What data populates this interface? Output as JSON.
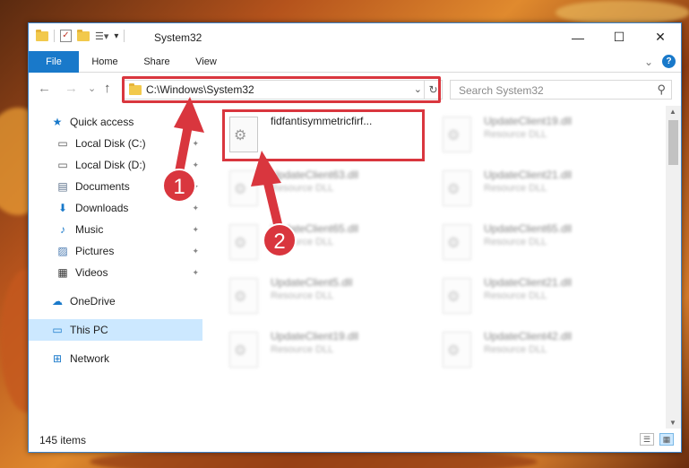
{
  "window": {
    "title": "System32"
  },
  "window_buttons": {
    "minimize": "—",
    "maximize": "☐",
    "close": "✕"
  },
  "ribbon": {
    "tabs": [
      {
        "label": "File",
        "active": true
      },
      {
        "label": "Home"
      },
      {
        "label": "Share"
      },
      {
        "label": "View"
      }
    ],
    "collapse_glyph": "⌄",
    "help_glyph": "?"
  },
  "nav": {
    "back": "←",
    "forward": "→",
    "recent": "⌄",
    "up": "↑",
    "address_path": "C:\\Windows\\System32",
    "address_chevron": "⌄",
    "refresh": "↻",
    "search_placeholder": "Search System32",
    "search_glyph": "⚲"
  },
  "sidebar": {
    "items": [
      {
        "label": "Quick access",
        "icon": "star-icon",
        "glyph": "★",
        "color": "#1979ca",
        "pinned": false
      },
      {
        "label": "Local Disk (C:)",
        "icon": "drive-icon",
        "glyph": "▭",
        "color": "#555555",
        "pinned": true
      },
      {
        "label": "Local Disk (D:)",
        "icon": "drive-icon",
        "glyph": "▭",
        "color": "#555555",
        "pinned": true
      },
      {
        "label": "Documents",
        "icon": "document-icon",
        "glyph": "▤",
        "color": "#5a6f8a",
        "pinned": true
      },
      {
        "label": "Downloads",
        "icon": "download-icon",
        "glyph": "⬇",
        "color": "#1979ca",
        "pinned": true
      },
      {
        "label": "Music",
        "icon": "music-icon",
        "glyph": "♪",
        "color": "#1979ca",
        "pinned": true
      },
      {
        "label": "Pictures",
        "icon": "pictures-icon",
        "glyph": "▨",
        "color": "#4a7ab0",
        "pinned": true
      },
      {
        "label": "Videos",
        "icon": "video-icon",
        "glyph": "▦",
        "color": "#333333",
        "pinned": true
      },
      {
        "label": "OneDrive",
        "icon": "cloud-icon",
        "glyph": "☁",
        "color": "#1979ca",
        "pinned": false
      },
      {
        "label": "This PC",
        "icon": "computer-icon",
        "glyph": "▭",
        "color": "#1979ca",
        "pinned": false,
        "selected": true
      },
      {
        "label": "Network",
        "icon": "network-icon",
        "glyph": "⊞",
        "color": "#1979ca",
        "pinned": false
      }
    ],
    "pin_glyph": "📌"
  },
  "files": [
    {
      "name": "fidfantisymmetricfirf...",
      "type": "",
      "highlighted": true
    },
    {
      "name": "UpdateClient19.dll",
      "type": "Resource DLL"
    },
    {
      "name": "UpdateClient63.dll",
      "type": "Resource DLL"
    },
    {
      "name": "UpdateClient21.dll",
      "type": "Resource DLL"
    },
    {
      "name": "UpdateClient65.dll",
      "type": "Resource DLL"
    },
    {
      "name": "UpdateClient65.dll",
      "type": "Resource DLL"
    },
    {
      "name": "UpdateClient5.dll",
      "type": "Resource DLL"
    },
    {
      "name": "UpdateClient21.dll",
      "type": "Resource DLL"
    },
    {
      "name": "UpdateClient19.dll",
      "type": "Resource DLL"
    },
    {
      "name": "UpdateClient42.dll",
      "type": "Resource DLL"
    }
  ],
  "status": {
    "item_count": "145 items"
  },
  "annotations": [
    {
      "label": "1",
      "color": "#d9363e"
    },
    {
      "label": "2",
      "color": "#d9363e"
    }
  ],
  "colors": {
    "accent": "#1979ca",
    "highlight": "#d9363e",
    "selection": "#cce8ff"
  }
}
